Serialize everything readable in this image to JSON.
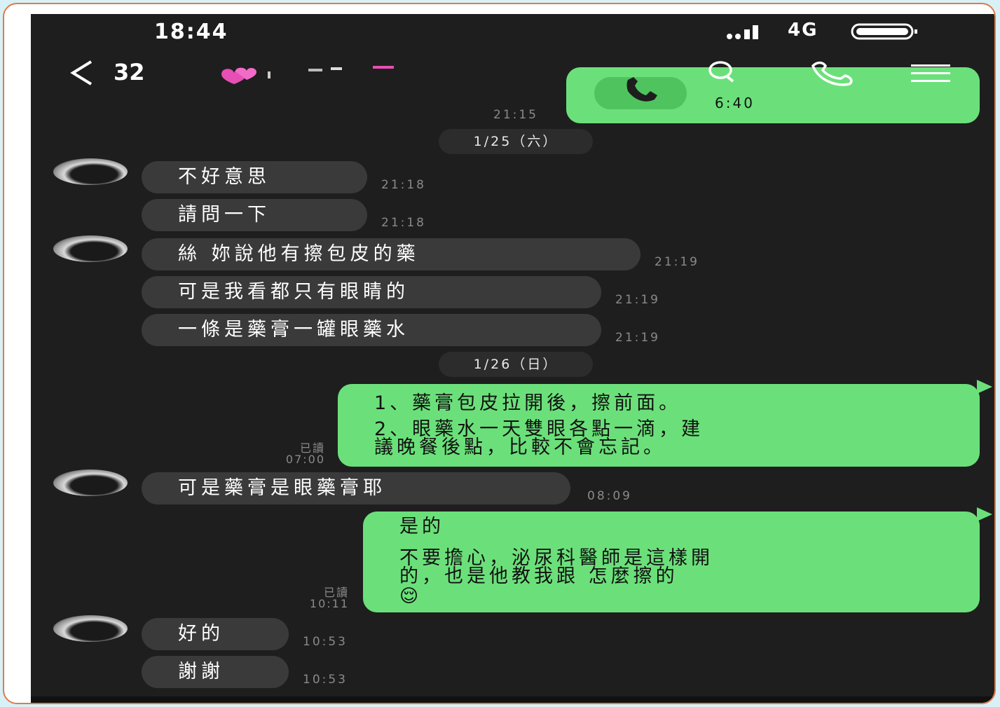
{
  "status_bar": {
    "time": "18:44",
    "network": "4G"
  },
  "header": {
    "back_count": "32",
    "call_label": "6:40"
  },
  "messages": [
    {
      "text": "不好意思",
      "time": "21:18"
    },
    {
      "text": "請問一下",
      "time": "21:18"
    },
    {
      "text": "絲  妳說他有擦包皮的藥",
      "time": "21:19"
    },
    {
      "text": "可是我看都只有眼睛的",
      "time": "21:19"
    },
    {
      "text": "一條是藥膏一罐眼藥水",
      "time": "21:19"
    },
    {
      "text": "可是藥膏是眼藥膏耶",
      "time": "08:09"
    },
    {
      "text": "好的",
      "time": "10:53"
    },
    {
      "text": "謝謝",
      "time": "10:53"
    }
  ],
  "dates": [
    "1/25（六）",
    "1/26（日）"
  ],
  "call_time": "21:15",
  "outgoing": [
    {
      "line1": "1、藥膏包皮拉開後，擦前面。",
      "line2": "2、眼藥水一天雙眼各點一滴，建",
      "line3": "議晚餐後點，比較不會忘記。",
      "read": "已讀",
      "time": "07:00"
    },
    {
      "line1": "是的",
      "line2": "不要擔心，泌尿科醫師是這樣開",
      "line3": "的，也是他教我跟  怎麼擦的",
      "emoji": "😌",
      "read": "已讀",
      "time": "10:11"
    }
  ],
  "colors": {
    "bubble_out": "#6be07a",
    "bubble_in": "#3a3a3b",
    "screen_bg": "#1e1e1f",
    "frame_border": "#e07a4a"
  }
}
